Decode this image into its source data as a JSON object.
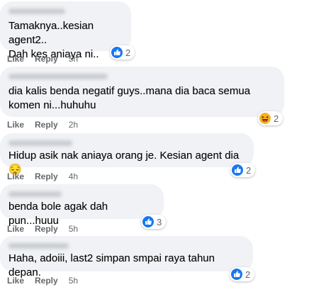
{
  "comments": [
    {
      "text": "Tamaknya..kesian agent2..\nDah kes aniaya ni..",
      "like": "Like",
      "reply": "Reply",
      "time": "5h",
      "reaction": "like-icon",
      "count": "2"
    },
    {
      "text": "dia kalis benda negatif guys..mana dia baca semua\nkomen ni...huhuhu",
      "like": "Like",
      "reply": "Reply",
      "time": "2h",
      "reaction": "haha-icon",
      "count": "2"
    },
    {
      "text": "Hidup asik nak aniaya orang je. Kesian agent dia 😔",
      "like": "Like",
      "reply": "Reply",
      "time": "4h",
      "reaction": "like-icon",
      "count": "2"
    },
    {
      "text": "benda bole agak dah pun...huuu",
      "like": "Like",
      "reply": "Reply",
      "time": "5h",
      "reaction": "like-icon",
      "count": "3"
    },
    {
      "text": "Haha, adoiii, last2 simpan smpai raya tahun depan.",
      "like": "Like",
      "reply": "Reply",
      "time": "5h",
      "reaction": "like-icon",
      "count": "2"
    }
  ],
  "colors": {
    "bubble": "#f0f2f5",
    "like_blue": "#1877f2",
    "haha_yellow": "#f7b125",
    "meta_text": "#65676b"
  }
}
